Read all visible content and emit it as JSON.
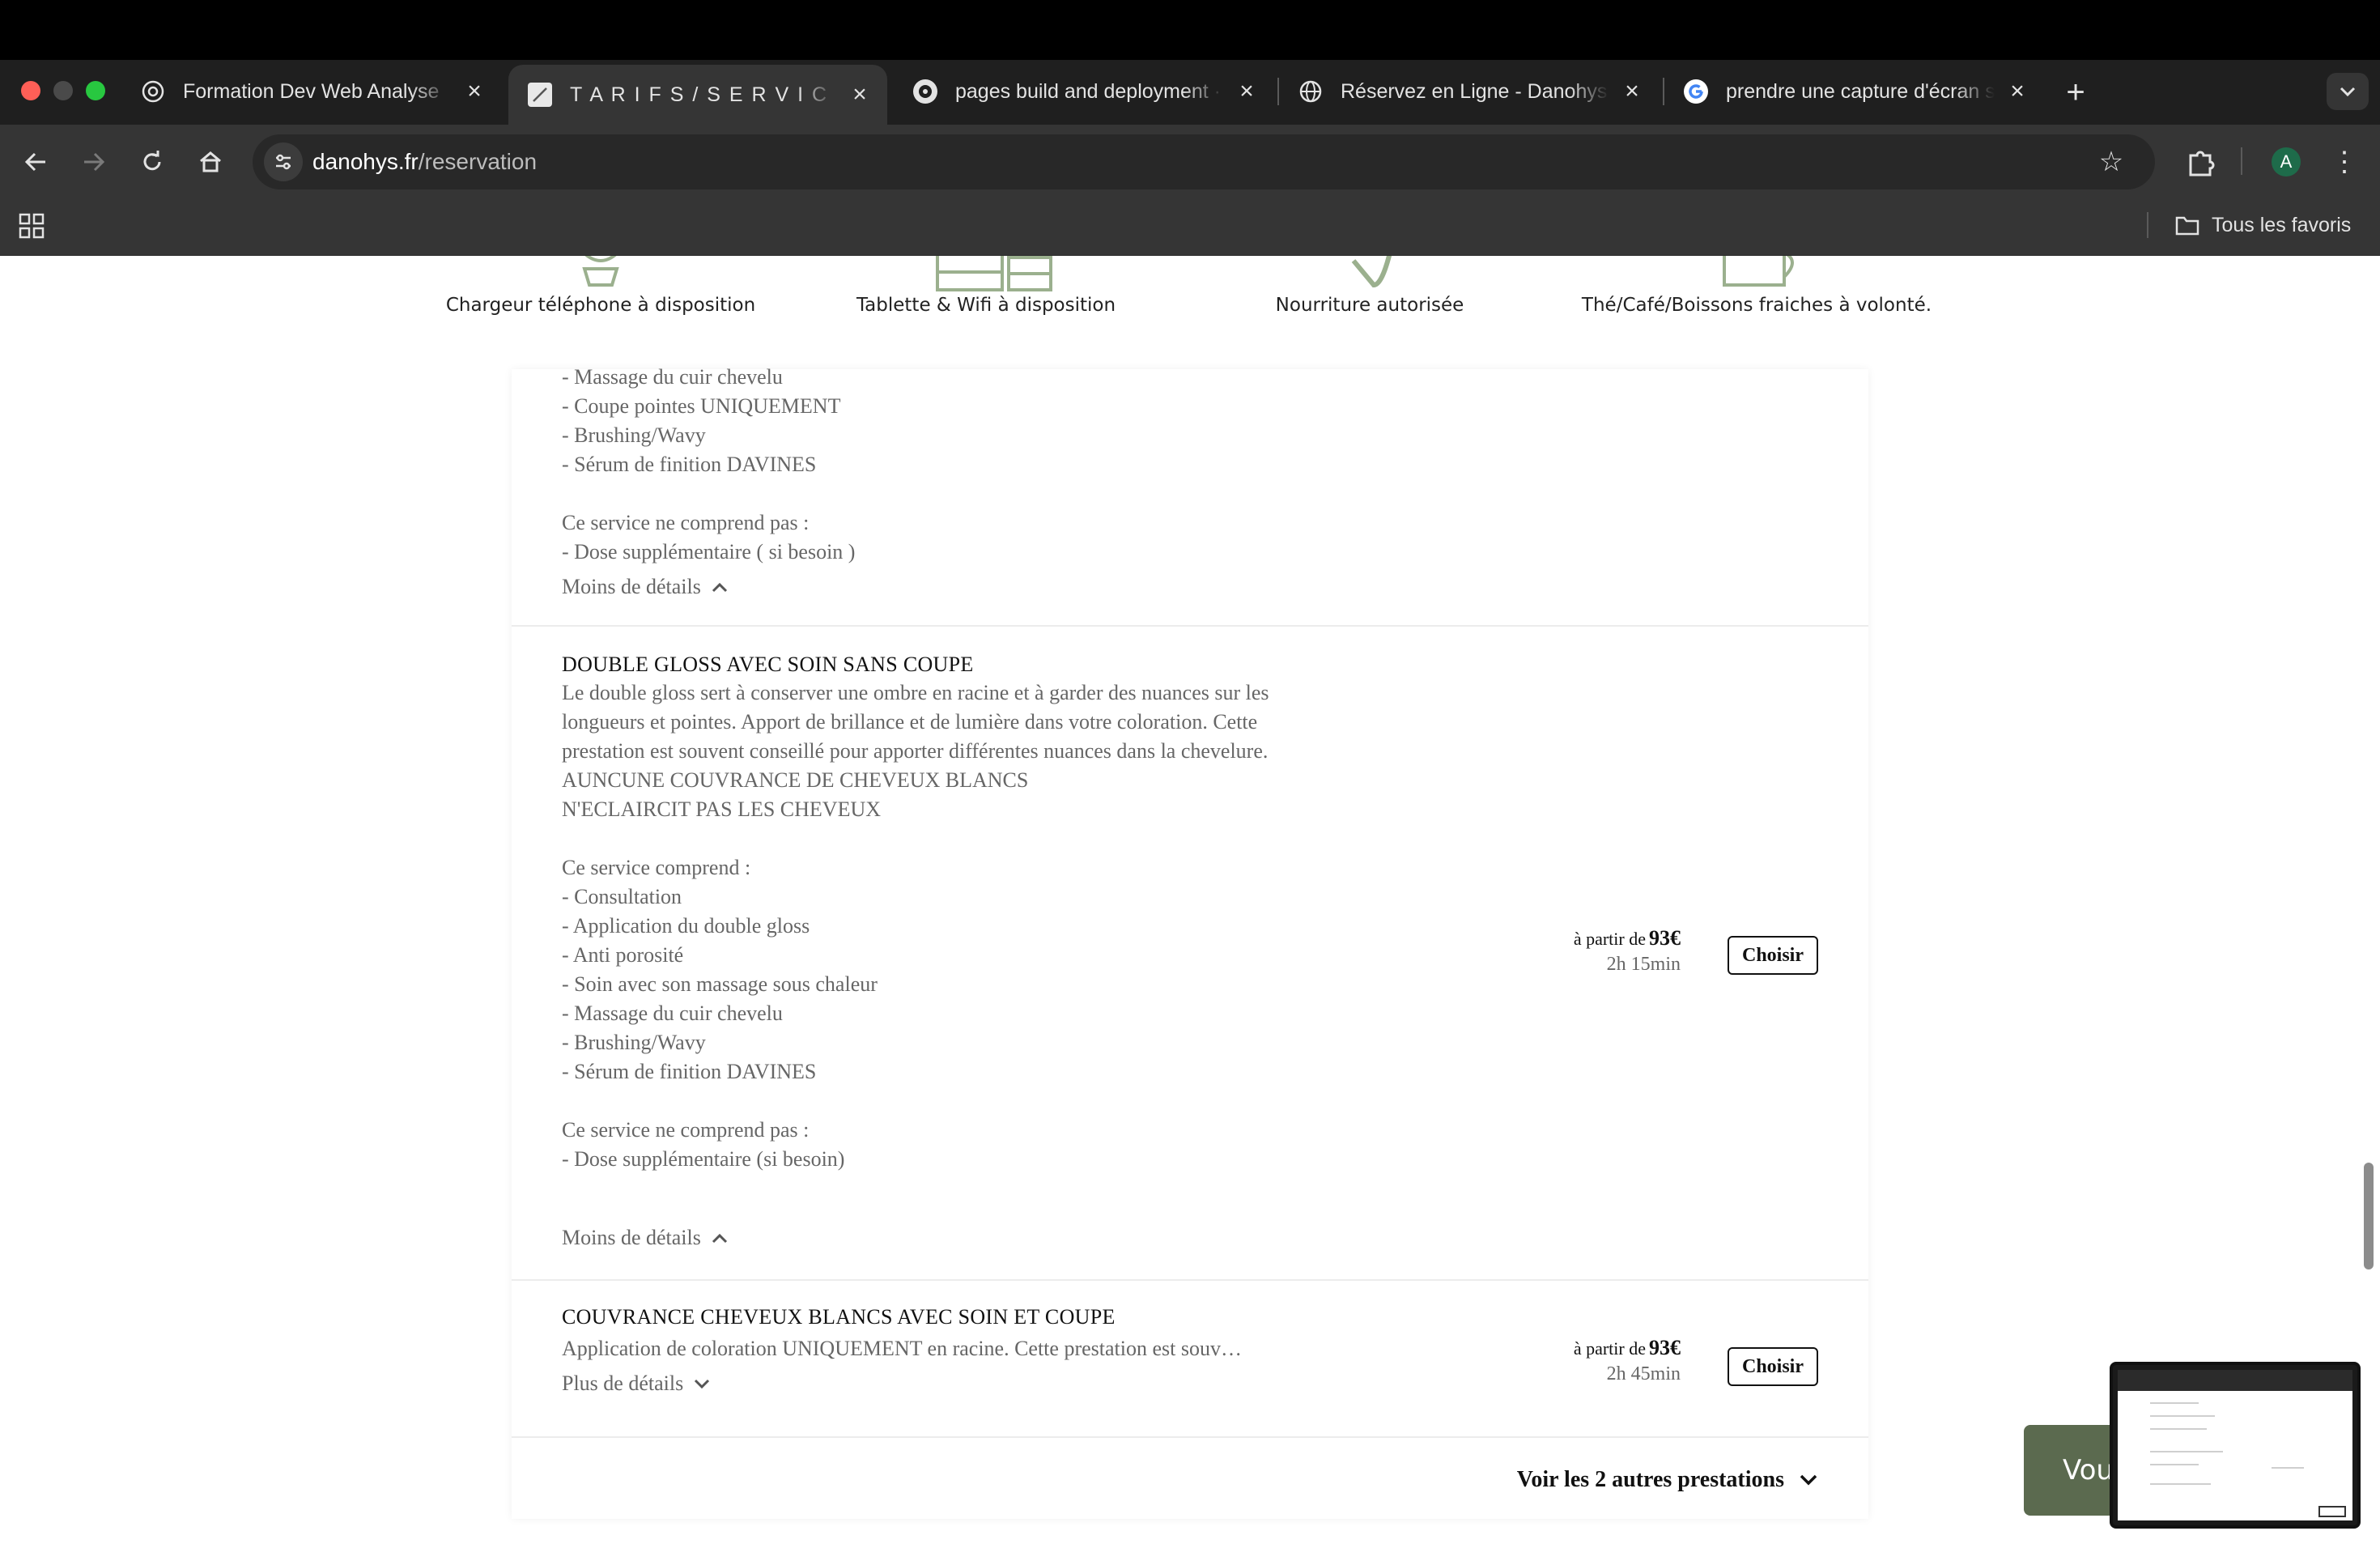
{
  "browser": {
    "tabs": [
      {
        "title": "Formation Dev Web Analyse",
        "favicon": "openai-icon"
      },
      {
        "title": "T A R I F S / S E R V I C E S | D",
        "favicon": "brush-icon",
        "active": true
      },
      {
        "title": "pages build and deployment ·",
        "favicon": "github-icon"
      },
      {
        "title": "Réservez en Ligne - Danohys",
        "favicon": "globe-icon"
      },
      {
        "title": "prendre une capture d'écran s",
        "favicon": "google-icon"
      }
    ],
    "url_host": "danohys.fr",
    "url_path": "/reservation",
    "bookmarks_all": "Tous les favoris",
    "profile_initial": "A"
  },
  "amenities": [
    {
      "label": "Chargeur téléphone à disposition",
      "icon": "charger-icon"
    },
    {
      "label": "Tablette & Wifi à disposition",
      "icon": "tablet-icon"
    },
    {
      "label": "Nourriture autorisée",
      "icon": "food-icon"
    },
    {
      "label": "Thé/Café/Boissons fraiches à volonté.",
      "icon": "cup-icon"
    }
  ],
  "services": [
    {
      "name": "",
      "description": "- Massage du cuir chevelu\n- Coupe pointes UNIQUEMENT\n- Brushing/Wavy\n- Sérum de finition DAVINES\n\nCe service ne comprend pas :\n- Dose supplémentaire ( si besoin )",
      "toggle": "Moins de détails"
    },
    {
      "name": "DOUBLE GLOSS AVEC SOIN SANS COUPE",
      "description": "Le double gloss sert à conserver une ombre en racine et à garder des nuances sur les longueurs et pointes. Apport de brillance et de lumière dans votre coloration. Cette prestation est souvent conseillé pour apporter différentes nuances dans la chevelure.\nAUNCUNE COUVRANCE DE CHEVEUX BLANCS\nN'ECLAIRCIT PAS LES CHEVEUX\n\nCe service comprend :\n- Consultation\n- Application du double gloss\n- Anti porosité\n- Soin avec son massage sous chaleur\n- Massage du cuir chevelu\n- Brushing/Wavy\n- Sérum de finition DAVINES\n\nCe service ne comprend pas :\n- Dose supplémentaire (si besoin)",
      "toggle": "Moins de détails",
      "price_prefix": "à partir de",
      "price": "93€",
      "duration": "2h 15min",
      "cta": "Choisir"
    },
    {
      "name": "COUVRANCE CHEVEUX BLANCS AVEC SOIN ET COUPE",
      "description": "Application de coloration UNIQUEMENT en racine. Cette prestation est souv…",
      "toggle": "Plus de détails",
      "price_prefix": "à partir de",
      "price": "93€",
      "duration": "2h 45min",
      "cta": "Choisir"
    }
  ],
  "more_services": "Voir les 2 autres prestations",
  "chat_button": "Vous",
  "colors": {
    "accent_green": "#5b6a4f",
    "icon_green": "#9bb08e",
    "chrome_dark": "#353535"
  }
}
